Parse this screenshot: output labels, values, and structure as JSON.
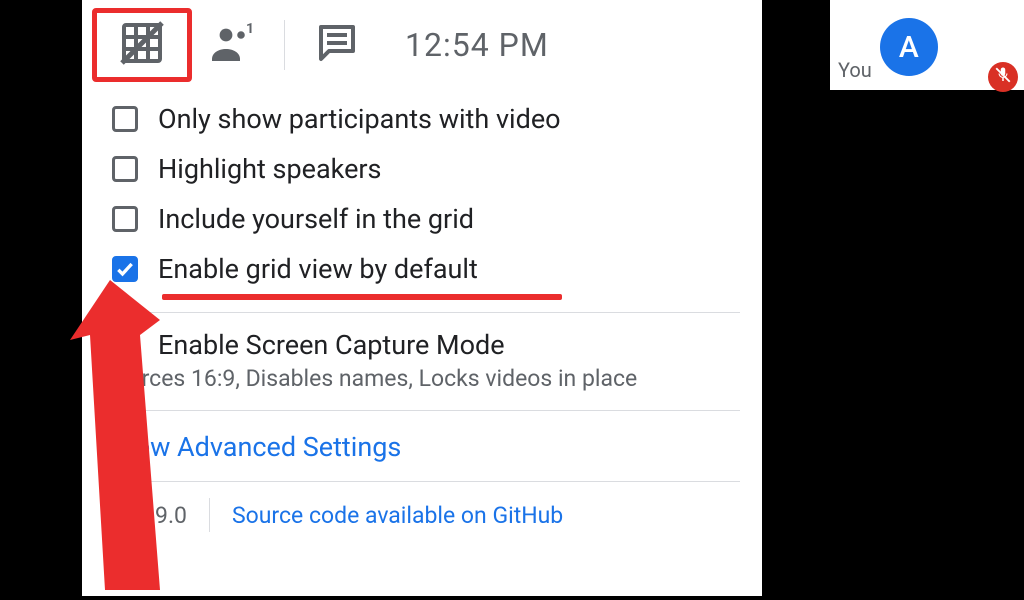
{
  "topbar": {
    "clock": "12:54 PM",
    "participants_count": "1"
  },
  "options": {
    "only_video": {
      "label": "Only show participants with video",
      "checked": false
    },
    "highlight": {
      "label": "Highlight speakers",
      "checked": false
    },
    "include_self": {
      "label": "Include yourself in the grid",
      "checked": false
    },
    "enable_grid": {
      "label": "Enable grid view by default",
      "checked": true
    }
  },
  "screen_capture": {
    "label": "Enable Screen Capture Mode",
    "subtitle": "Forces 16:9, Disables names, Locks videos in place",
    "checked": false
  },
  "advanced_link": "View Advanced Settings",
  "version": "v1.39.0",
  "source_link": "Source code available on GitHub",
  "user": {
    "you_label": "You",
    "avatar_initial": "A"
  }
}
